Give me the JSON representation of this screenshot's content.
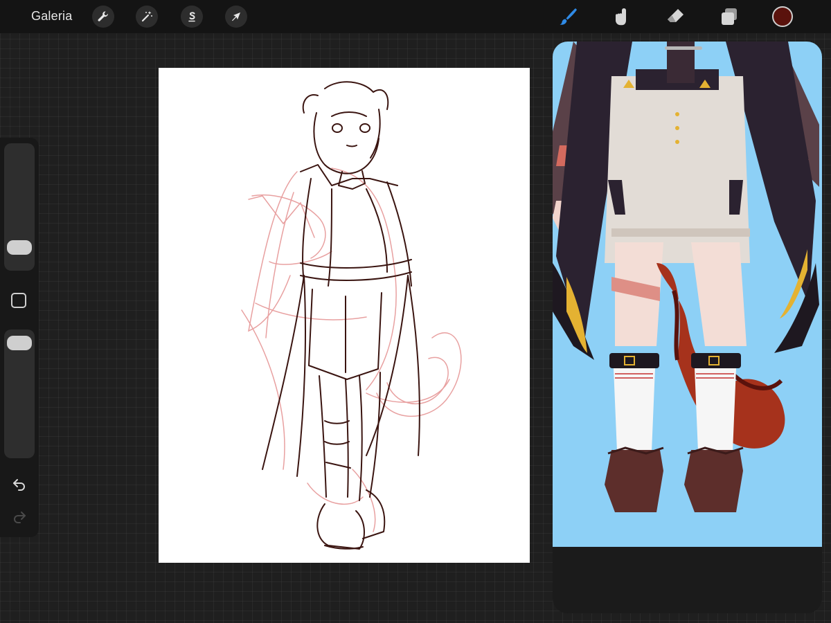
{
  "toolbar": {
    "gallery_label": "Galeria",
    "left_tools": [
      {
        "name": "wrench-icon",
        "role": "actions"
      },
      {
        "name": "magic-wand-icon",
        "role": "adjustments"
      },
      {
        "name": "selection-s-icon",
        "role": "selection"
      },
      {
        "name": "arrow-cursor-icon",
        "role": "transform"
      }
    ],
    "right_tools": [
      {
        "name": "brush-icon",
        "role": "paint",
        "active": true
      },
      {
        "name": "smudge-icon",
        "role": "smudge",
        "active": false
      },
      {
        "name": "eraser-icon",
        "role": "erase",
        "active": false
      },
      {
        "name": "layers-icon",
        "role": "layers",
        "active": false
      }
    ],
    "active_color": "#5a120c",
    "active_tool_color": "#2f8ae6"
  },
  "sidebar": {
    "brush_size_level": 0.12,
    "opacity_level": 0.97,
    "modify_button": "square-icon",
    "undo": "undo-icon",
    "redo": "redo-icon"
  },
  "canvas": {
    "background": "#ffffff",
    "line_color": "#3a1410",
    "sketch_color": "#e8a0a0"
  },
  "reference": {
    "background": "#8dd0f6",
    "panel_color": "#1b1b1b"
  }
}
